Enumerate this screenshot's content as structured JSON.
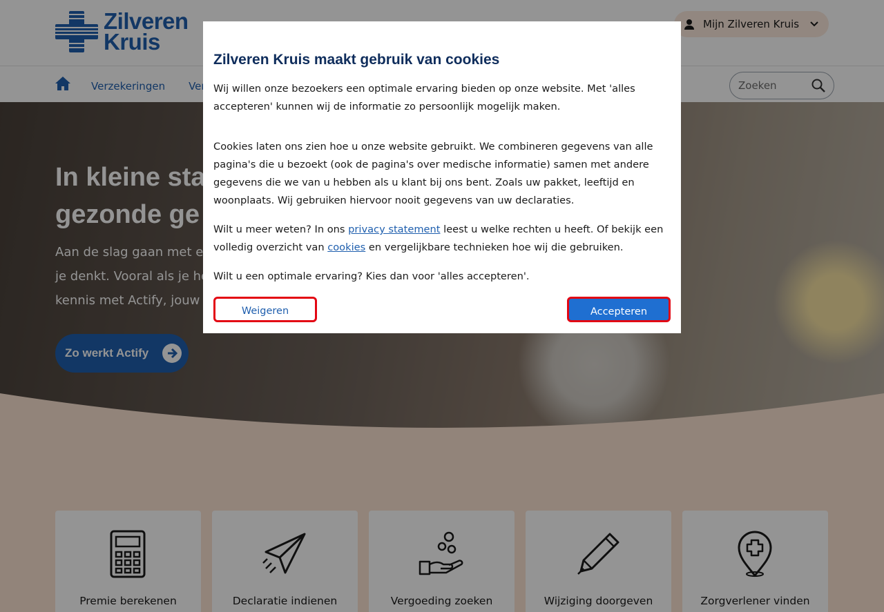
{
  "header": {
    "logo_line1": "Zilveren",
    "logo_line2": "Kruis",
    "account_label": "Mijn Zilveren Kruis",
    "search_placeholder": "Zoeken"
  },
  "nav": {
    "items": [
      "Verzekeringen",
      "Verg"
    ]
  },
  "hero": {
    "title": "In kleine sta\ngezonde ge",
    "text": "Aan de slag gaan met een\nje denkt. Vooral als je het\nkennis met Actify, jouw p",
    "cta_label": "Zo werkt Actify"
  },
  "tiles": [
    {
      "label": "Premie berekenen",
      "icon": "calculator-icon"
    },
    {
      "label": "Declaratie indienen",
      "icon": "paper-plane-icon"
    },
    {
      "label": "Vergoeding zoeken",
      "icon": "coins-hand-icon"
    },
    {
      "label": "Wijziging doorgeven",
      "icon": "pen-icon"
    },
    {
      "label": "Zorgverlener vinden",
      "icon": "location-cross-icon"
    }
  ],
  "cookie_modal": {
    "title": "Zilveren Kruis maakt gebruik van cookies",
    "p1": "Wij willen onze bezoekers een optimale ervaring bieden op onze website. Met 'alles accepteren' kunnen wij de informatie zo persoonlijk mogelijk maken.",
    "p2": "Cookies laten ons zien hoe u onze website gebruikt. We combineren gegevens van alle pagina's die u bezoekt (ook de pagina's over medische informatie) samen met andere gegevens die we van u hebben als u klant bij ons bent. Zoals uw pakket, leeftijd en woonplaats. Wij gebruiken hiervoor nooit gegevens van uw declaraties.",
    "p3_before": "Wilt u meer weten? In ons ",
    "p3_link1": "privacy statement",
    "p3_middle": " leest u welke rechten u heeft. Of bekijk een volledig overzicht van ",
    "p3_link2": "cookies",
    "p3_after": " en vergelijkbare technieken hoe wij die gebruiken.",
    "p4": "Wilt u een optimale ervaring? Kies dan voor 'alles accepteren'.",
    "reject_label": "Weigeren",
    "accept_label": "Accepteren"
  },
  "colors": {
    "brand_blue": "#1f5fae",
    "highlight_red": "#e30613",
    "accept_blue": "#1f6fd1",
    "peach": "#fbe3d3"
  }
}
